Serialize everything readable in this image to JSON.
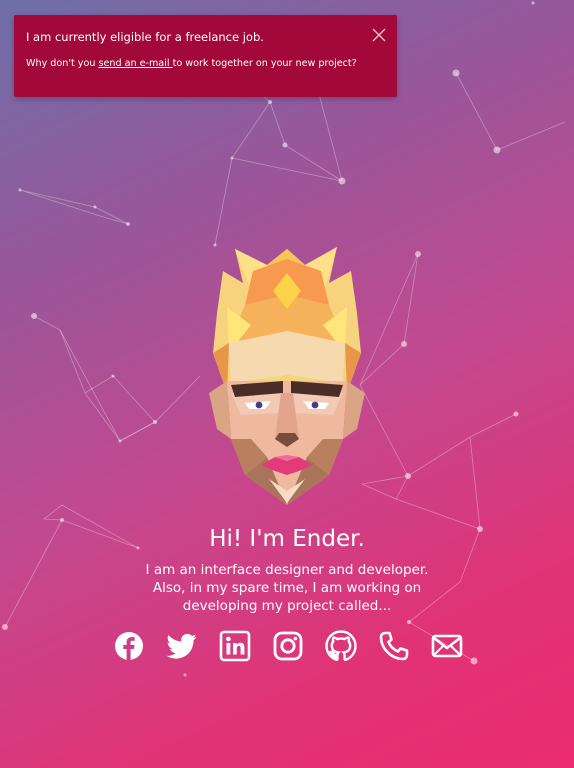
{
  "notice": {
    "title": "I am currently eligible for a freelance job.",
    "text_before": "Why don't you ",
    "link_label": "send an e-mail ",
    "text_after": "to work together on your new project?",
    "close_icon": "close-icon"
  },
  "hero": {
    "headline": "Hi! I'm Ender.",
    "bio_lines": [
      "I am an interface designer and developer.",
      "Also, in my spare time, I am working on",
      "developing my project called..."
    ]
  },
  "social_icons": [
    "facebook-icon",
    "twitter-icon",
    "linkedin-icon",
    "instagram-icon",
    "github-icon",
    "phone-icon",
    "mail-icon"
  ],
  "colors": {
    "notice_bg": "#a3083a",
    "gradient_start": "#6d6fa8",
    "gradient_end": "#ea2c6e",
    "text": "#ffffff"
  }
}
